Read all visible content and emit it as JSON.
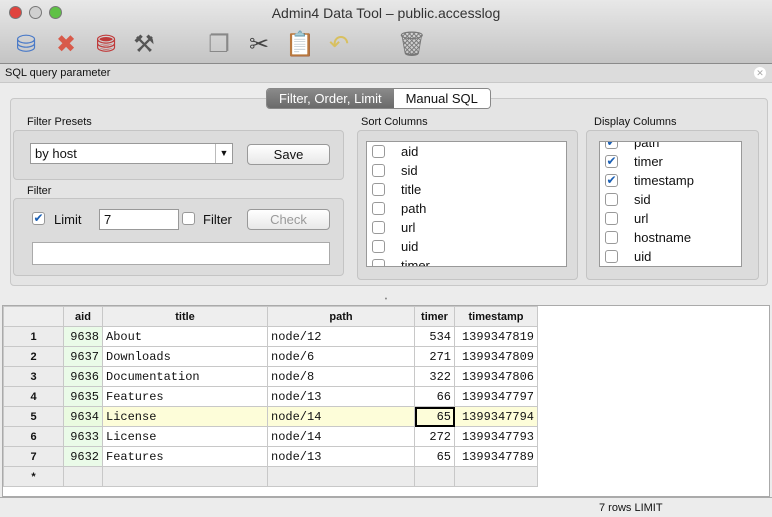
{
  "window": {
    "title": "Admin4 Data Tool – public.accesslog"
  },
  "toolbar": {
    "icons": [
      "refresh-db-icon",
      "cancel-icon",
      "save-db-icon",
      "settings-tools-icon",
      "copy-icon",
      "cut-icon",
      "paste-icon",
      "undo-icon",
      "trash-icon"
    ]
  },
  "panel": {
    "title": "SQL query parameter"
  },
  "tabs": [
    {
      "label": "Filter, Order, Limit"
    },
    {
      "label": "Manual SQL"
    }
  ],
  "filter_presets": {
    "label": "Filter Presets",
    "selected": "by host",
    "save": "Save"
  },
  "filter": {
    "label": "Filter",
    "limit_label": "Limit",
    "limit_value": "7",
    "filter_label": "Filter",
    "check": "Check",
    "expression": ""
  },
  "sort_columns": {
    "label": "Sort Columns",
    "items": [
      "aid",
      "sid",
      "title",
      "path",
      "url",
      "uid",
      "timer"
    ]
  },
  "display_columns": {
    "label": "Display Columns",
    "items": [
      {
        "name": "path",
        "checked": true
      },
      {
        "name": "timer",
        "checked": true
      },
      {
        "name": "timestamp",
        "checked": true
      },
      {
        "name": "sid",
        "checked": false
      },
      {
        "name": "url",
        "checked": false
      },
      {
        "name": "hostname",
        "checked": false
      },
      {
        "name": "uid",
        "checked": false
      }
    ]
  },
  "grid": {
    "columns": [
      "aid",
      "title",
      "path",
      "timer",
      "timestamp"
    ],
    "rows": [
      [
        "1",
        "9638",
        "About",
        "node/12",
        "534",
        "1399347819"
      ],
      [
        "2",
        "9637",
        "Downloads",
        "node/6",
        "271",
        "1399347809"
      ],
      [
        "3",
        "9636",
        "Documentation",
        "node/8",
        "322",
        "1399347806"
      ],
      [
        "4",
        "9635",
        "Features",
        "node/13",
        "66",
        "1399347797"
      ],
      [
        "5",
        "9634",
        "License",
        "node/14",
        "65",
        "1399347794"
      ],
      [
        "6",
        "9633",
        "License",
        "node/14",
        "272",
        "1399347793"
      ],
      [
        "7",
        "9632",
        "Features",
        "node/13",
        "65",
        "1399347789"
      ]
    ],
    "new_row_marker": "*"
  },
  "status": {
    "text": "7 rows LIMIT"
  }
}
